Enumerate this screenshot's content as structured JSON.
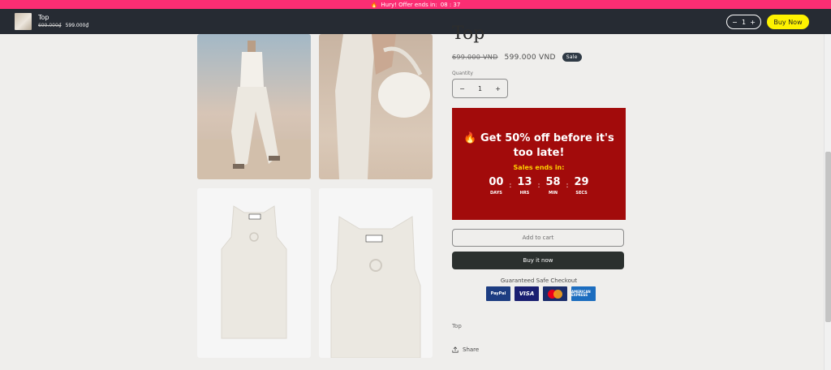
{
  "promo_bar": {
    "icon": "fire-icon",
    "text": "Hury! Offer ends in:",
    "timer": "08 : 37"
  },
  "sticky_bar": {
    "title": "Top",
    "old_price": "699.000₫",
    "new_price": "599.000₫",
    "qty_minus": "−",
    "qty_value": "1",
    "qty_plus": "+",
    "buy_label": "Buy Now",
    "buy_color": "#fef200"
  },
  "product": {
    "title": "Top",
    "old_price": "699.000 VND",
    "new_price": "599.000 VND",
    "sale_badge": "Sale",
    "quantity_label": "Quantity",
    "qty_minus": "−",
    "qty_value": "1",
    "qty_plus": "+",
    "meta_text": "Top",
    "share_label": "Share"
  },
  "offer": {
    "icon": "fire-icon",
    "title": "Get 50% off before it's too late!",
    "subtitle": "Sales ends in:",
    "bg_color": "#a20b0b",
    "countdown": [
      {
        "value": "00",
        "label": "DAYS"
      },
      {
        "value": "13",
        "label": "HRS"
      },
      {
        "value": "58",
        "label": "MIN"
      },
      {
        "value": "29",
        "label": "SECS"
      }
    ]
  },
  "actions": {
    "add_to_cart": "Add to cart",
    "buy_now": "Buy it now"
  },
  "checkout": {
    "guarantee": "Guaranteed Safe Checkout",
    "cards": [
      {
        "name": "paypal-icon",
        "text": "PayPal"
      },
      {
        "name": "visa-icon",
        "text": "VISA"
      },
      {
        "name": "mastercard-icon",
        "text": ""
      },
      {
        "name": "amex-icon",
        "text": "AMERICAN EXPRESS"
      }
    ]
  }
}
